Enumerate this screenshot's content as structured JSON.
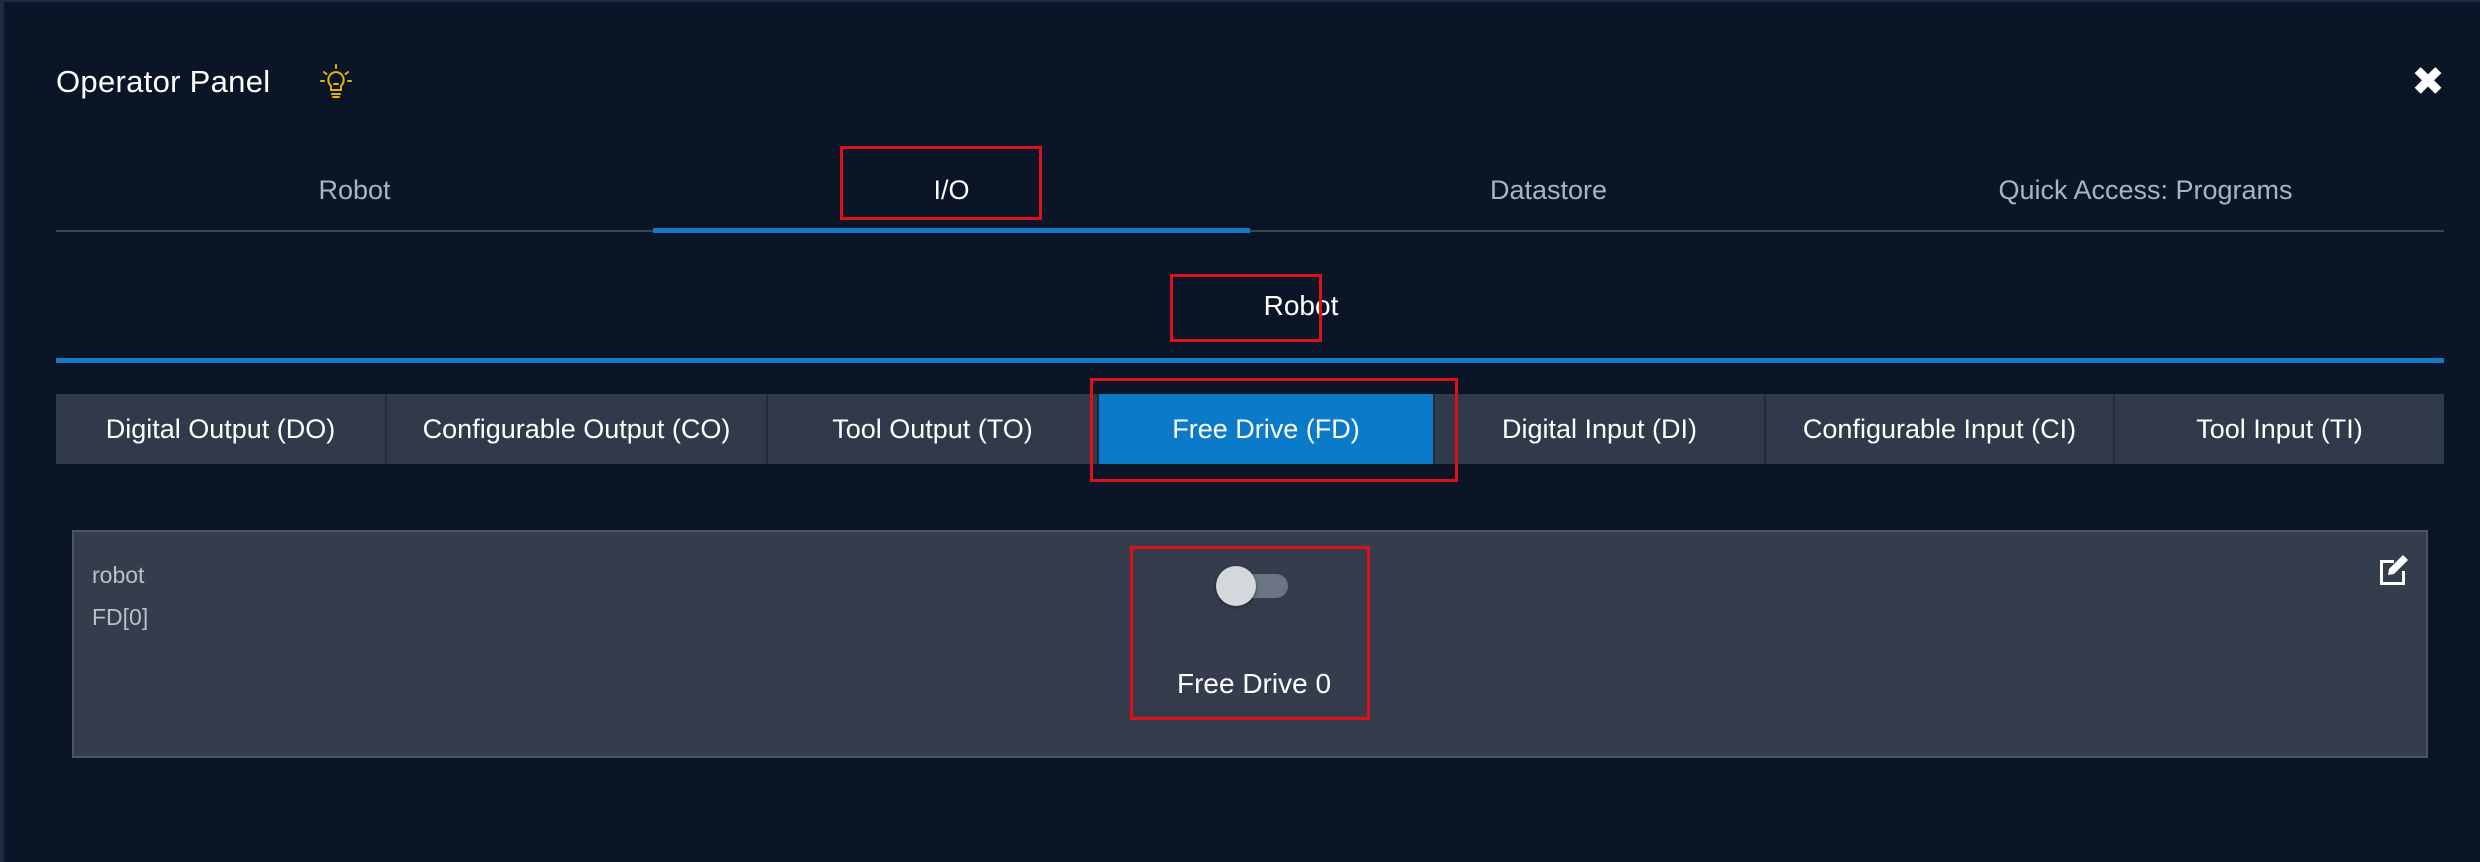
{
  "panel": {
    "title": "Operator Panel",
    "close_icon": "close-icon",
    "bulb_icon": "lightbulb-icon",
    "accent_color": "#1878c8",
    "highlight_color": "#e0101a"
  },
  "main_tabs": [
    {
      "label": "Robot",
      "active": false
    },
    {
      "label": "I/O",
      "active": true
    },
    {
      "label": "Datastore",
      "active": false
    },
    {
      "label": "Quick Access: Programs",
      "active": false
    }
  ],
  "sub_tab": {
    "label": "Robot"
  },
  "io_tabs": [
    {
      "label": "Digital Output (DO)",
      "active": false
    },
    {
      "label": "Configurable Output (CO)",
      "active": false
    },
    {
      "label": "Tool Output (TO)",
      "active": false
    },
    {
      "label": "Free Drive (FD)",
      "active": true
    },
    {
      "label": "Digital Input (DI)",
      "active": false
    },
    {
      "label": "Configurable Input (CI)",
      "active": false
    },
    {
      "label": "Tool Input (TI)",
      "active": false
    }
  ],
  "io_item": {
    "source": "robot",
    "address": "FD[0]",
    "label": "Free Drive 0",
    "state": false,
    "edit_icon": "edit-icon"
  }
}
